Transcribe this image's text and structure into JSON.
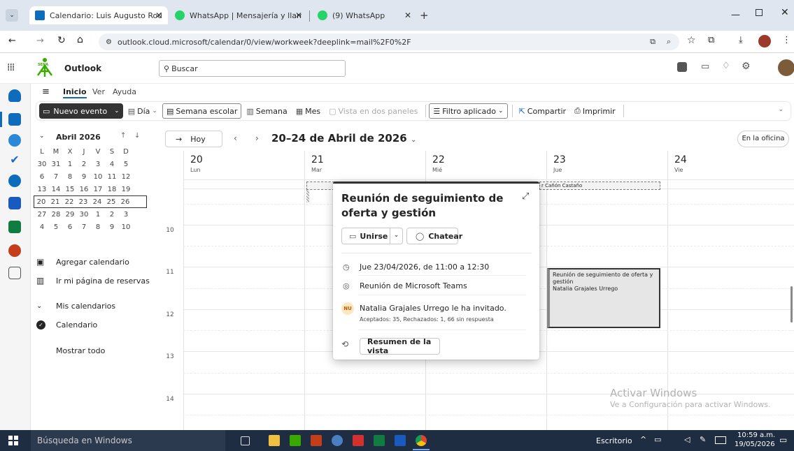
{
  "browser": {
    "tabs": [
      {
        "title": "Calendario: Luis Augusto Rodrig",
        "active": true
      },
      {
        "title": "WhatsApp | Mensajería y llama",
        "active": false
      },
      {
        "title": "(9) WhatsApp",
        "active": false
      }
    ],
    "new_tab": "+",
    "url": "outlook.cloud.microsoft/calendar/0/view/workweek?deeplink=mail%2F0%2F"
  },
  "outlook": {
    "brand": "SENA",
    "app_name": "Outlook",
    "search_placeholder": "Buscar"
  },
  "ribbon": {
    "tabs": [
      "Inicio",
      "Ver",
      "Ayuda"
    ],
    "new_event": "Nuevo evento",
    "day": "Día",
    "school_week": "Semana escolar",
    "week": "Semana",
    "month": "Mes",
    "split_view": "Vista en dos paneles",
    "filter": "Filtro aplicado",
    "share": "Compartir",
    "print": "Imprimir"
  },
  "minical": {
    "month": "Abril 2026",
    "weekdays": [
      "L",
      "M",
      "X",
      "J",
      "V",
      "S",
      "D"
    ],
    "weeks": [
      [
        "30",
        "31",
        "1",
        "2",
        "3",
        "4",
        "5"
      ],
      [
        "6",
        "7",
        "8",
        "9",
        "10",
        "11",
        "12"
      ],
      [
        "13",
        "14",
        "15",
        "16",
        "17",
        "18",
        "19"
      ],
      [
        "20",
        "21",
        "22",
        "23",
        "24",
        "25",
        "26"
      ],
      [
        "27",
        "28",
        "29",
        "30",
        "1",
        "2",
        "3"
      ],
      [
        "4",
        "5",
        "6",
        "7",
        "8",
        "9",
        "10"
      ]
    ],
    "selected_week_index": 3
  },
  "sidebar": {
    "add_calendar": "Agregar calendario",
    "booking_page": "Ir mi página de reservas",
    "my_calendars": "Mis calendarios",
    "calendar": "Calendario",
    "show_all": "Mostrar todo"
  },
  "calendar": {
    "today_button": "Hoy",
    "range_title": "20–24 de Abril de 2026",
    "status_button": "En la oficina",
    "days": [
      {
        "num": "20",
        "name": "Lun"
      },
      {
        "num": "21",
        "name": "Mar"
      },
      {
        "num": "22",
        "name": "Mié"
      },
      {
        "num": "23",
        "name": "Jue"
      },
      {
        "num": "24",
        "name": "Vie"
      }
    ],
    "hours": [
      "10",
      "11",
      "12",
      "13",
      "14"
    ],
    "allday_event_text": "r Cañón Castaño",
    "event": {
      "title": "Reunión de seguimiento de oferta y gestión",
      "organizer": "Natalia Grajales Urrego"
    }
  },
  "popup": {
    "title": "Reunión de seguimiento de oferta y gestión",
    "join": "Unirse",
    "chat": "Chatear",
    "datetime": "Jue 23/04/2026, de 11:00 a 12:30",
    "location": "Reunión de Microsoft Teams",
    "avatar_initials": "NU",
    "invited_by": "Natalia Grajales Urrego le ha invitado.",
    "responses": "Aceptados: 35, Rechazados: 1, 66 sin respuesta",
    "summary_button": "Resumen de la vista"
  },
  "watermark": {
    "line1": "Activar Windows",
    "line2": "Ve a Configuración para activar Windows."
  },
  "taskbar": {
    "search": "Búsqueda en Windows",
    "desktop": "Escritorio",
    "time": "10:59 a.m.",
    "date": "19/05/2026"
  },
  "colors": {
    "tab_bar": "#dfe6ef",
    "outlook_blue": "#0f6cbd",
    "taskbar": "#1f2d42",
    "sena_green": "#39a900"
  }
}
